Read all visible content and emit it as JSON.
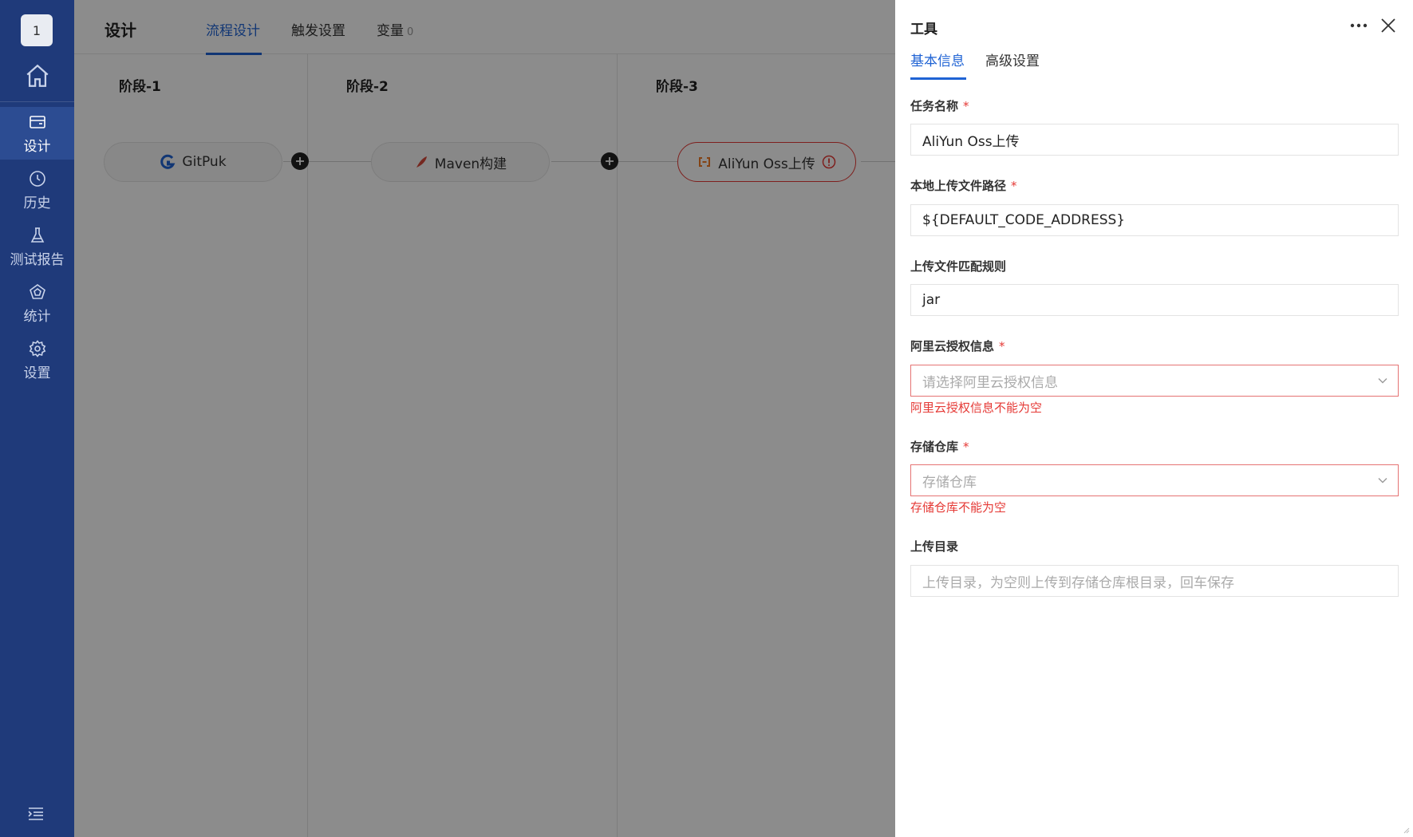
{
  "sidebar": {
    "avatar_text": "1",
    "items": [
      {
        "label": "设计",
        "icon": "design-icon",
        "active": true
      },
      {
        "label": "历史",
        "icon": "clock-icon",
        "active": false
      },
      {
        "label": "测试报告",
        "icon": "flask-icon",
        "active": false
      },
      {
        "label": "统计",
        "icon": "pentagon-icon",
        "active": false
      },
      {
        "label": "设置",
        "icon": "gear-icon",
        "active": false
      }
    ],
    "bg_color": "#1f3a7a"
  },
  "header": {
    "title": "设计",
    "tabs": [
      {
        "label": "流程设计",
        "active": true
      },
      {
        "label": "触发设置",
        "active": false
      },
      {
        "label": "变量",
        "count": "0",
        "active": false
      }
    ]
  },
  "pipeline": {
    "stages": [
      {
        "title": "阶段-1",
        "task": {
          "label": "GitPuk",
          "icon": "gitpuk-icon",
          "error": false
        }
      },
      {
        "title": "阶段-2",
        "task": {
          "label": "Maven构建",
          "icon": "feather-icon",
          "error": false
        }
      },
      {
        "title": "阶段-3",
        "task": {
          "label": "AliYun Oss上传",
          "icon": "aliyun-icon",
          "error": true
        }
      }
    ]
  },
  "drawer": {
    "title": "工具",
    "tabs": [
      {
        "label": "基本信息",
        "active": true
      },
      {
        "label": "高级设置",
        "active": false
      }
    ],
    "fields": {
      "task_name": {
        "label": "任务名称",
        "required": true,
        "value": "AliYun Oss上传"
      },
      "local_path": {
        "label": "本地上传文件路径",
        "required": true,
        "value": "${DEFAULT_CODE_ADDRESS}"
      },
      "match_rule": {
        "label": "上传文件匹配规则",
        "required": false,
        "value": "jar"
      },
      "aliyun_auth": {
        "label": "阿里云授权信息",
        "required": true,
        "placeholder": "请选择阿里云授权信息",
        "error": "阿里云授权信息不能为空"
      },
      "bucket": {
        "label": "存储仓库",
        "required": true,
        "placeholder": "存储仓库",
        "error": "存储仓库不能为空"
      },
      "upload_dir": {
        "label": "上传目录",
        "required": false,
        "placeholder": "上传目录，为空则上传到存储仓库根目录，回车保存"
      }
    },
    "required_mark": "*"
  },
  "colors": {
    "accent": "#1f63d4",
    "error": "#e53935"
  }
}
